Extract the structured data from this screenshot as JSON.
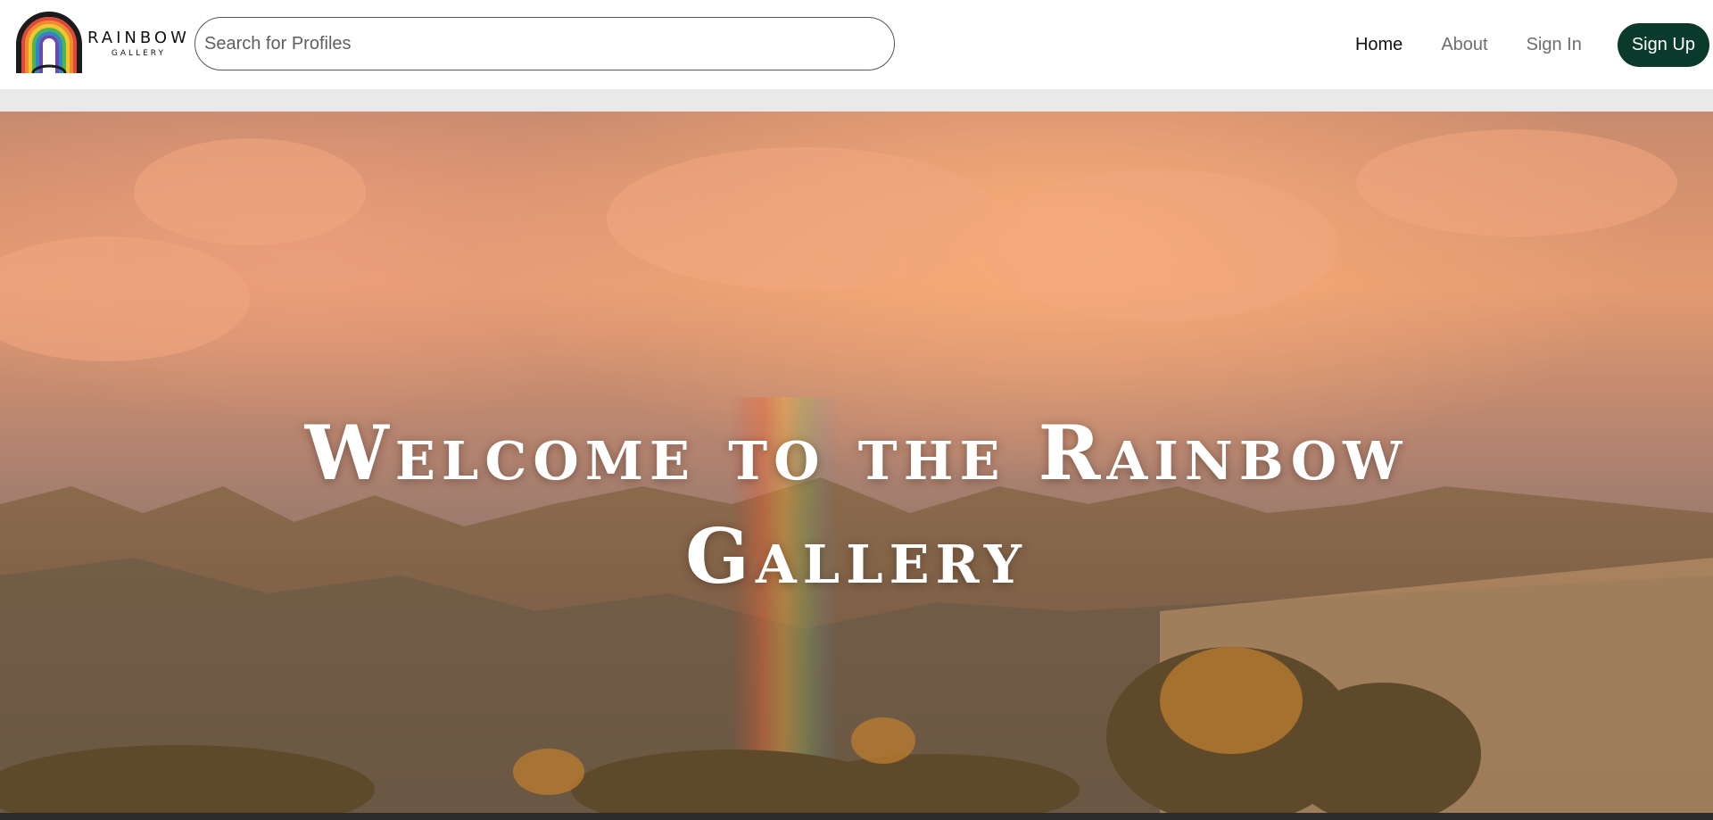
{
  "brand": {
    "name": "RAINBOW",
    "subtitle": "GALLERY",
    "icon": "rainbow-arch-logo"
  },
  "search": {
    "placeholder": "Search for Profiles",
    "value": ""
  },
  "nav": {
    "home": "Home",
    "about": "About",
    "sign_in": "Sign In",
    "sign_up": "Sign Up"
  },
  "hero": {
    "title": "Welcome to the Rainbow Gallery",
    "image": "sunset-clouds-mountains-rainbow-photo"
  },
  "colors": {
    "signup_bg": "#0a3a2c",
    "active_link": "#111111",
    "inactive_link": "#6e6e6e",
    "strip": "#e9e9e9"
  }
}
